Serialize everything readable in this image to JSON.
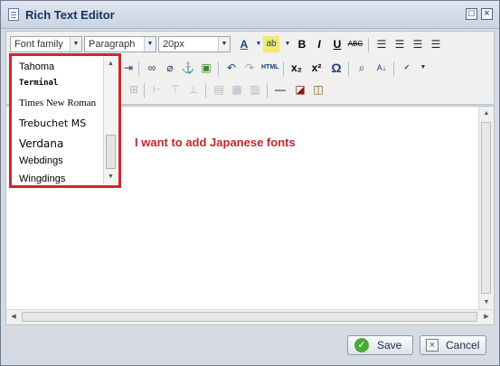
{
  "window": {
    "title": "Rich Text Editor",
    "minimize_glyph": "□",
    "close_glyph": "×"
  },
  "toolbar": {
    "font_family": "Font family",
    "format": "Paragraph",
    "font_size": "20px",
    "html_label": "HTML",
    "subscript_label": "x₂",
    "superscript_label": "x²",
    "omega_glyph": "Ω",
    "bold": "B",
    "italic": "I",
    "underline": "U",
    "strike": "ABC"
  },
  "font_dropdown": {
    "items": [
      "Tahoma",
      "Terminal",
      "Times New Roman",
      "Trebuchet MS",
      "Verdana",
      "Webdings",
      "Wingdings"
    ]
  },
  "annotation": {
    "text": "I want to add Japanese fonts",
    "color": "#c1272d"
  },
  "footer": {
    "save_label": "Save",
    "cancel_label": "Cancel"
  }
}
